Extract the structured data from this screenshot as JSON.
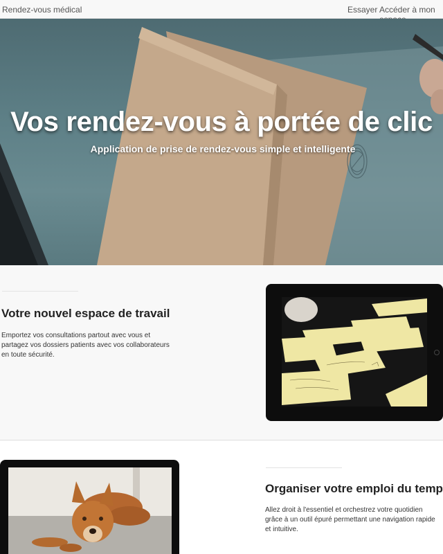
{
  "navbar": {
    "brand": "Rendez-vous médical",
    "links": [
      "Essayer",
      "Accéder à mon espace"
    ]
  },
  "hero": {
    "title": "Vos rendez-vous à portée de clic",
    "subtitle": "Application de prise de rendez-vous simple et intelligente"
  },
  "features": [
    {
      "title": "Votre nouvel espace de travail",
      "text": "Emportez vos consultations partout avec vous et partagez vos dossiers patients avec vos collaborateurs en toute sécurité."
    },
    {
      "title": "Organiser votre emploi du temps",
      "text": "Allez droit à l'essentiel et orchestrez votre quotidien grâce à un outil épuré permettant une navigation rapide et intuitive."
    }
  ],
  "colors": {
    "navbar_bg": "#f8f8f8",
    "hero_bg": "#5d7f86",
    "text": "#333333",
    "title": "#222222"
  },
  "icons": {
    "hero_image": "envelope-desk-photo",
    "tablet_image_1": "sticky-notes-photo",
    "tablet_image_2": "dog-photo"
  }
}
